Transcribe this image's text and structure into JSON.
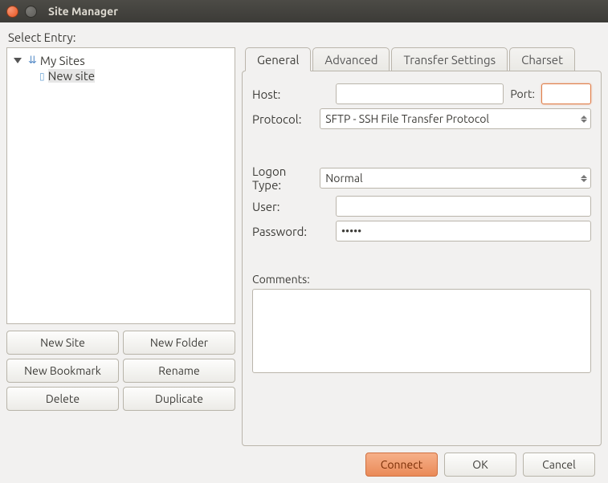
{
  "window": {
    "title": "Site Manager"
  },
  "sidebar": {
    "select_label": "Select Entry:",
    "root_label": "My Sites",
    "items": [
      {
        "label": "New site"
      }
    ],
    "buttons": {
      "new_site": "New Site",
      "new_folder": "New Folder",
      "new_bookmark": "New Bookmark",
      "rename": "Rename",
      "delete": "Delete",
      "duplicate": "Duplicate"
    }
  },
  "tabs": {
    "general": "General",
    "advanced": "Advanced",
    "transfer": "Transfer Settings",
    "charset": "Charset"
  },
  "form": {
    "host_label": "Host:",
    "host_value": "",
    "port_label": "Port:",
    "port_value": "",
    "protocol_label": "Protocol:",
    "protocol_value": "SFTP - SSH File Transfer Protocol",
    "logon_type_label": "Logon Type:",
    "logon_type_value": "Normal",
    "user_label": "User:",
    "user_value": "",
    "password_label": "Password:",
    "password_value": "•••••",
    "comments_label": "Comments:",
    "comments_value": ""
  },
  "footer": {
    "connect": "Connect",
    "ok": "OK",
    "cancel": "Cancel"
  }
}
